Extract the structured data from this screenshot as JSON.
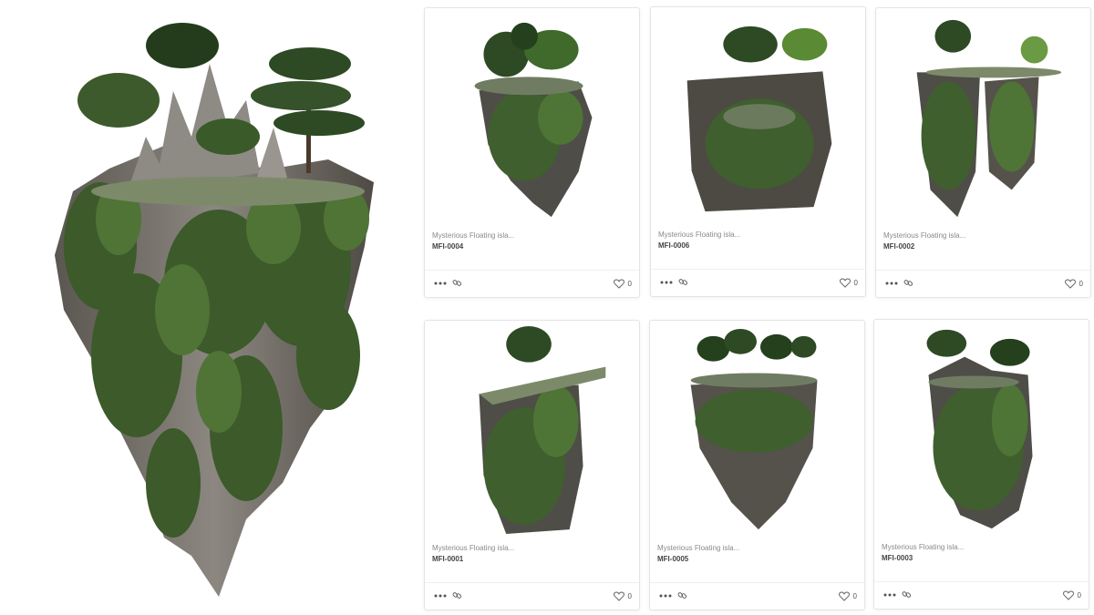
{
  "hero": {
    "icon": "floating-island-render"
  },
  "cards": [
    {
      "title": "Mysterious Floating isla...",
      "code": "MFI-0004",
      "likes": "0",
      "variant": "trees-top"
    },
    {
      "title": "Mysterious Floating isla...",
      "code": "MFI-0006",
      "likes": "0",
      "variant": "canyon"
    },
    {
      "title": "Mysterious Floating isla...",
      "code": "MFI-0002",
      "likes": "0",
      "variant": "twin-pillars"
    },
    {
      "title": "Mysterious Floating isla...",
      "code": "MFI-0001",
      "likes": "0",
      "variant": "ledge"
    },
    {
      "title": "Mysterious Floating isla...",
      "code": "MFI-0005",
      "likes": "0",
      "variant": "palms"
    },
    {
      "title": "Mysterious Floating isla...",
      "code": "MFI-0003",
      "likes": "0",
      "variant": "spire"
    }
  ],
  "icons": {
    "more": "more-dots-icon",
    "link": "link-icon",
    "like": "heart-icon"
  }
}
